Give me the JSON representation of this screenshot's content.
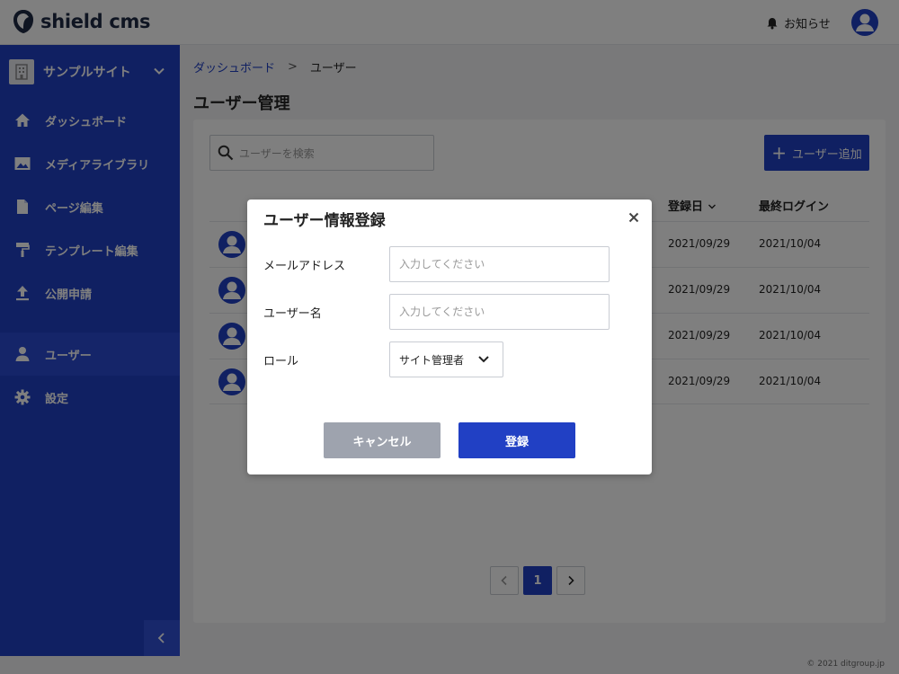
{
  "header": {
    "logo_text": "shield cms",
    "notice_label": "お知らせ"
  },
  "sidebar": {
    "site_name": "サンプルサイト",
    "items": [
      {
        "label": "ダッシュボード",
        "icon": "home-icon"
      },
      {
        "label": "メディアライブラリ",
        "icon": "image-icon"
      },
      {
        "label": "ページ編集",
        "icon": "file-icon"
      },
      {
        "label": "テンプレート編集",
        "icon": "paint-roller-icon"
      },
      {
        "label": "公開申請",
        "icon": "upload-icon"
      },
      {
        "label": "ユーザー",
        "icon": "user-icon",
        "active": true
      },
      {
        "label": "設定",
        "icon": "gear-icon"
      }
    ]
  },
  "breadcrumb": {
    "parent": "ダッシュボード",
    "separator": ">",
    "current": "ユーザー"
  },
  "page": {
    "title": "ユーザー管理",
    "search_placeholder": "ユーザーを検索",
    "add_button_label": "ユーザー追加",
    "columns": {
      "registered": "登録日",
      "last_login": "最終ログイン"
    },
    "rows": [
      {
        "registered": "2021/09/29",
        "last_login": "2021/10/04"
      },
      {
        "registered": "2021/09/29",
        "last_login": "2021/10/04"
      },
      {
        "registered": "2021/09/29",
        "last_login": "2021/10/04"
      },
      {
        "registered": "2021/09/29",
        "last_login": "2021/10/04"
      }
    ],
    "pagination": {
      "current": "1"
    }
  },
  "footer": {
    "copyright": "© 2021 ditgroup.jp"
  },
  "modal": {
    "title": "ユーザー情報登録",
    "email_label": "メールアドレス",
    "email_placeholder": "入力してください",
    "email_value": "",
    "username_label": "ユーザー名",
    "username_placeholder": "入力してください",
    "username_value": "",
    "role_label": "ロール",
    "role_value": "サイト管理者",
    "cancel_label": "キャンセル",
    "submit_label": "登録"
  },
  "colors": {
    "primary": "#2140c4",
    "cancel": "#9ea3ae"
  }
}
